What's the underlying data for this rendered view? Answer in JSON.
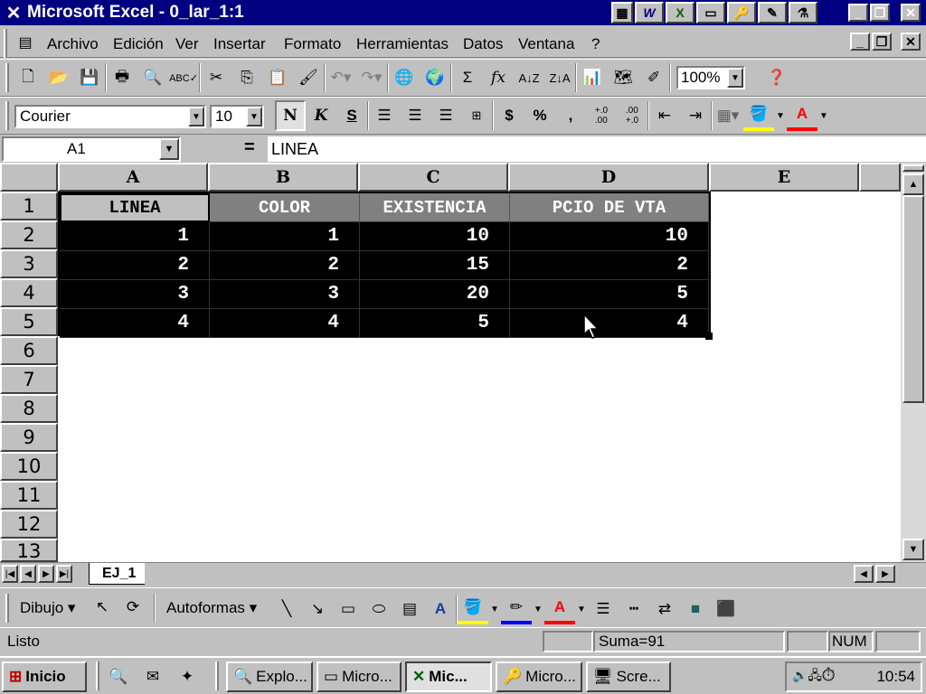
{
  "window": {
    "title": "Microsoft Excel - 0_lar_1:1"
  },
  "office_bar": [
    "W",
    "X",
    "▭",
    "🔑",
    "✎",
    "⚗"
  ],
  "menu": [
    "Archivo",
    "Edición",
    "Ver",
    "Insertar",
    "Formato",
    "Herramientas",
    "Datos",
    "Ventana",
    "?"
  ],
  "standard_toolbar": {
    "zoom": "100%"
  },
  "format_toolbar": {
    "font": "Courier",
    "size": "10",
    "bold_label": "N",
    "italic_label": "K",
    "underline_label": "S",
    "currency": "$",
    "percent": "%",
    "thousands": ",",
    "inc_decimals": "+.0\n.00",
    "dec_decimals": ".00\n+.0"
  },
  "formula_bar": {
    "name_box": "A1",
    "equals": "=",
    "content": "LINEA"
  },
  "columns": [
    "A",
    "B",
    "C",
    "D",
    "E"
  ],
  "rows": [
    "1",
    "2",
    "3",
    "4",
    "5",
    "6",
    "7",
    "8",
    "9",
    "10",
    "11",
    "12",
    "13"
  ],
  "table": {
    "headers": [
      "LINEA",
      "COLOR",
      "EXISTENCIA",
      "PCIO DE VTA"
    ],
    "rows": [
      [
        "1",
        "1",
        "10",
        "10"
      ],
      [
        "2",
        "2",
        "15",
        "2"
      ],
      [
        "3",
        "3",
        "20",
        "5"
      ],
      [
        "4",
        "4",
        "5",
        "4"
      ]
    ]
  },
  "sheet_tab": "EJ_1",
  "draw_toolbar": {
    "dibujo": "Dibujo",
    "autoformas": "Autoformas"
  },
  "status": {
    "left": "Listo",
    "sum": "Suma=91",
    "num": "NUM"
  },
  "taskbar": {
    "start": "Inicio",
    "tasks": [
      "Explo...",
      "Micro...",
      "Mic...",
      "Micro...",
      "Scre..."
    ],
    "clock": "10:54"
  },
  "colors": {
    "title_bg": "#000080",
    "header_cell": "#808080",
    "data_cell": "#000000"
  }
}
